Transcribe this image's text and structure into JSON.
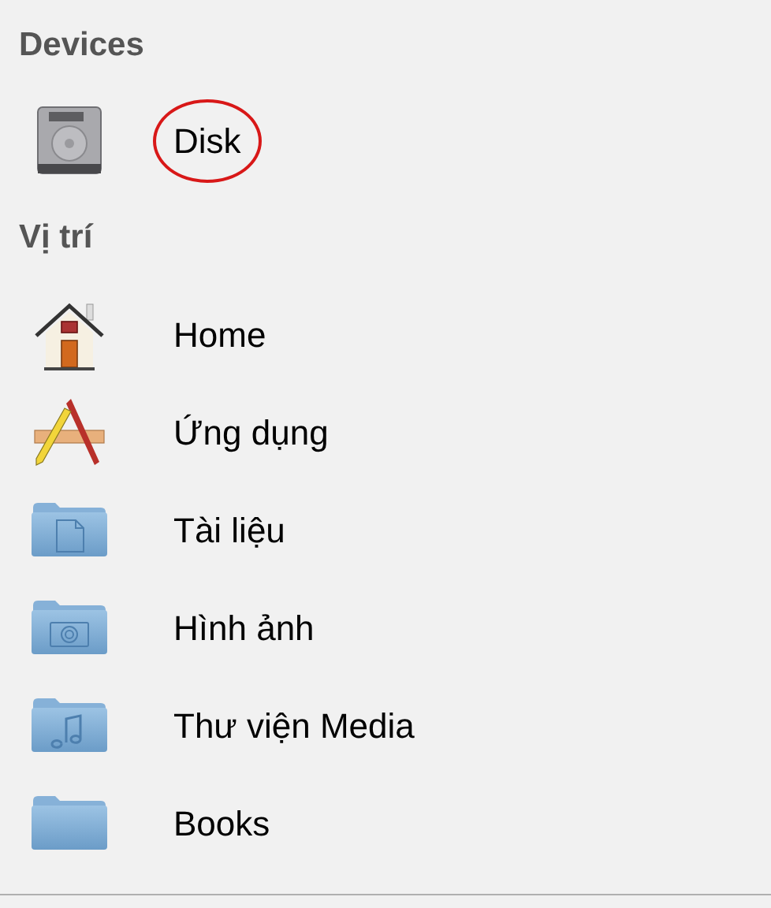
{
  "sections": [
    {
      "title": "Devices",
      "items": [
        {
          "kind": "disk",
          "label": "Disk",
          "circled": true
        }
      ]
    },
    {
      "title": "Vị trí",
      "items": [
        {
          "kind": "home",
          "label": "Home",
          "circled": false
        },
        {
          "kind": "apps",
          "label": "Ứng dụng",
          "circled": false
        },
        {
          "kind": "folder-document",
          "label": "Tài liệu",
          "circled": false
        },
        {
          "kind": "folder-camera",
          "label": "Hình ảnh",
          "circled": false
        },
        {
          "kind": "folder-music",
          "label": "Thư viện Media",
          "circled": false
        },
        {
          "kind": "folder",
          "label": "Books",
          "circled": false
        }
      ]
    }
  ]
}
